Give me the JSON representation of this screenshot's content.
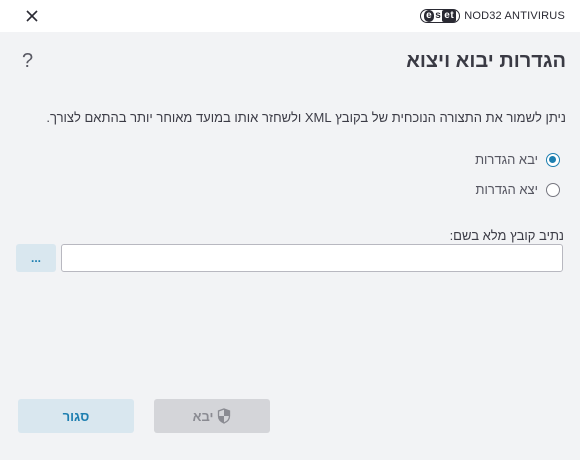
{
  "window": {
    "brand_logo": "eset",
    "product_name": "NOD32 ANTIVIRUS",
    "close_icon": "close-icon",
    "help_icon": "?"
  },
  "dialog": {
    "title": "הגדרות יבוא ויצוא",
    "description": "ניתן לשמור את התצורה הנוכחית של בקובץ XML ולשחזר אותו במועד מאוחר יותר בהתאם לצורך.",
    "options": [
      {
        "label": "יבא הגדרות",
        "selected": true
      },
      {
        "label": "יצא הגדרות",
        "selected": false
      }
    ],
    "path_label": "נתיב קובץ מלא בשם:",
    "path_value": "",
    "browse_label": "...",
    "close_label": "סגור",
    "import_label": "יבא",
    "import_icon": "shield-icon",
    "accent_color": "#1e7fb0"
  }
}
